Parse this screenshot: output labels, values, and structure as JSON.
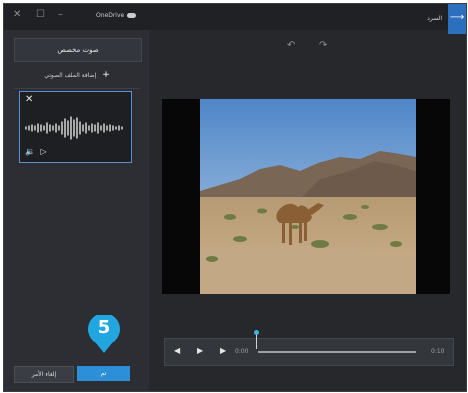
{
  "window": {
    "app_title": "OneDrive",
    "controls": [
      "✕",
      "☐",
      "–"
    ],
    "back_label": "السرد",
    "back_icon": "⟶"
  },
  "panel": {
    "title": "صوت مخصص",
    "add_track": "إضافة الملف الصوتي",
    "add_icon": "+",
    "audio_card": {
      "close_icon": "✕",
      "volume_icon": "🔉",
      "play_icon": "▷"
    }
  },
  "callout": {
    "number": "5"
  },
  "buttons": {
    "cancel": "إلغاء الأمر",
    "done": "تم"
  },
  "toolbar": {
    "undo_icon": "↶",
    "redo_icon": "↷"
  },
  "player": {
    "rewind_icon": "◀",
    "play_icon": "▶",
    "forward_icon": "▶",
    "current_time": "0:00",
    "total_time": "0:10"
  },
  "colors": {
    "accent": "#2c8fd8",
    "callout": "#22a6e0",
    "selection_border": "#5a8fd0"
  }
}
